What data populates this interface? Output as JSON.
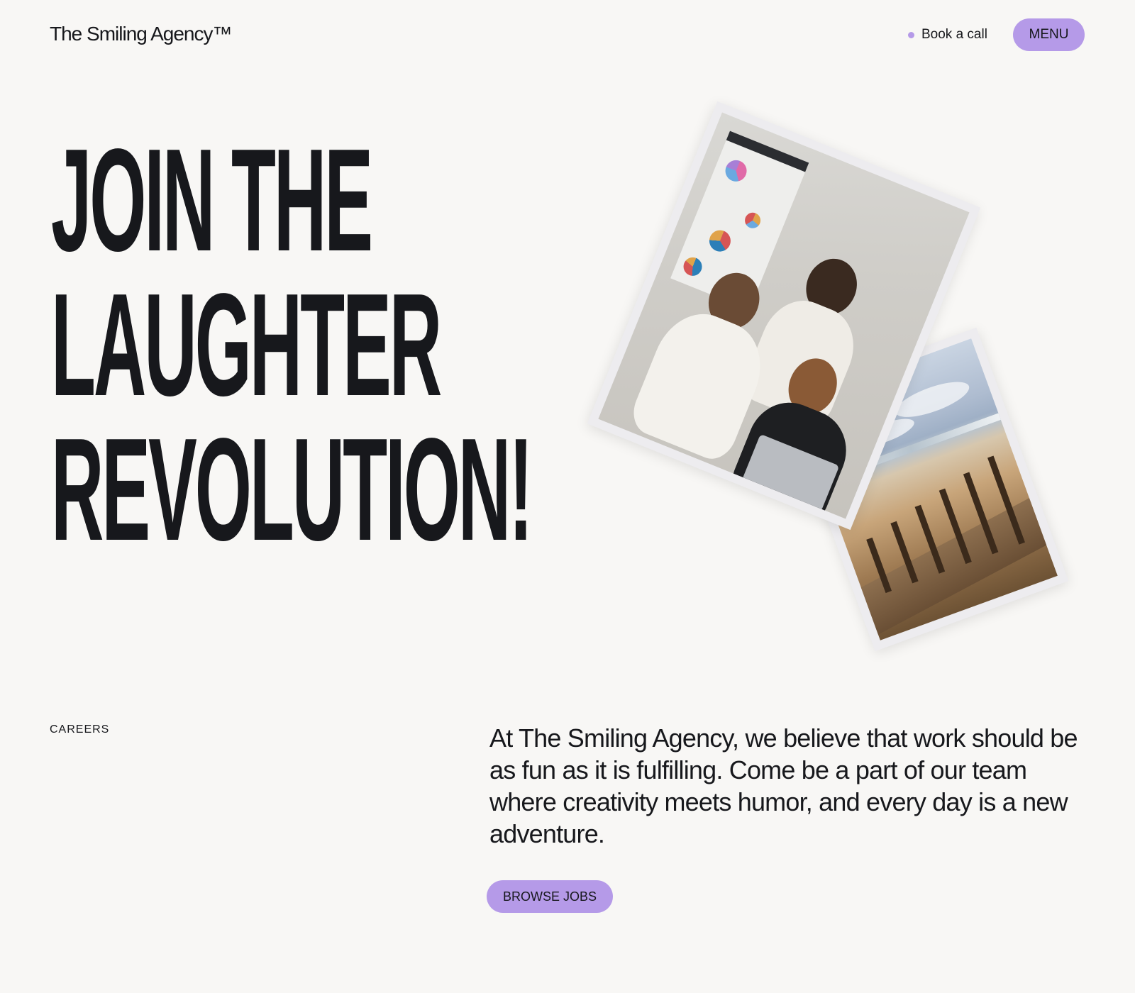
{
  "header": {
    "logo": "The Smiling Agency™",
    "book_call_label": "Book a call",
    "menu_label": "MENU"
  },
  "hero": {
    "headline_lines": [
      "JOIN THE",
      "LAUGHTER",
      "REVOLUTION!"
    ]
  },
  "careers": {
    "label": "CAREERS",
    "intro": "At The Smiling Agency, we believe that work should be as fun as it is fulfilling. Come be a part of our team where creativity meets humor, and every day is a new adventure.",
    "cta_label": "BROWSE JOBS"
  },
  "colors": {
    "accent": "#b59ae8",
    "background": "#f8f7f5",
    "text": "#17181c"
  }
}
